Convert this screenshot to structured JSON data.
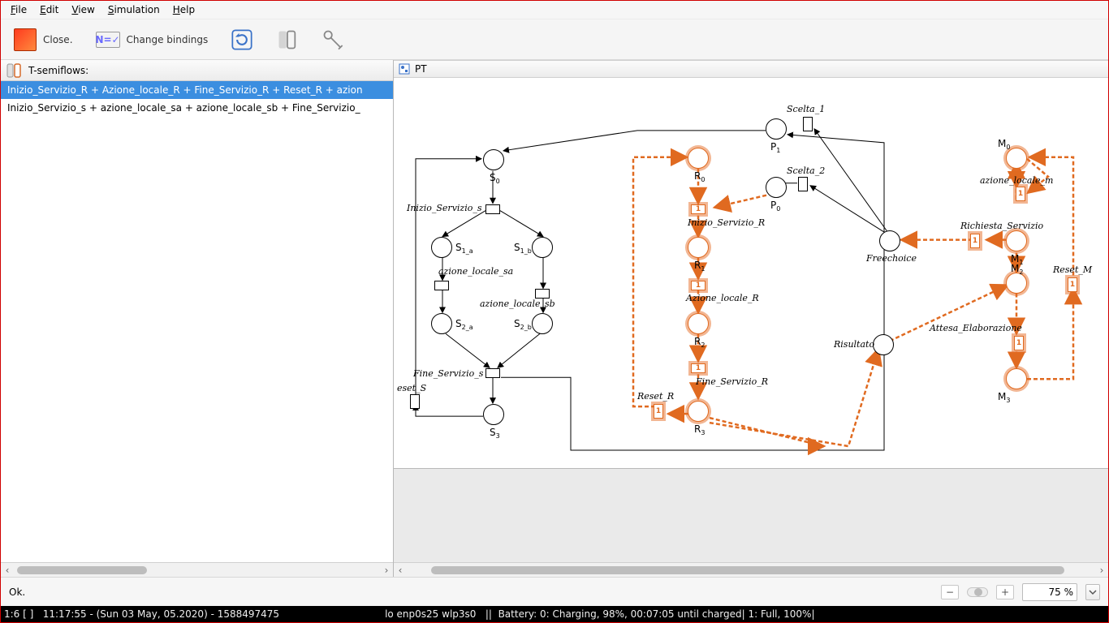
{
  "menubar": {
    "file": "File",
    "edit": "Edit",
    "view": "View",
    "simulation": "Simulation",
    "help": "Help"
  },
  "toolbar": {
    "close_label": "Close.",
    "change_bindings_label": "Change bindings",
    "bindings_icon_text": "N=✓"
  },
  "left": {
    "title": "T-semiflows:",
    "items": [
      "Inizio_Servizio_R + Azione_locale_R + Fine_Servizio_R + Reset_R + azion",
      "Inizio_Servizio_s + azione_locale_sa + azione_locale_sb + Fine_Servizio_"
    ]
  },
  "right": {
    "tab_label": "PT"
  },
  "nodes": {
    "S0": "S",
    "S0s": "0",
    "Inizio_Servizio_s": "Inizio_Servizio_s",
    "S1a": "S",
    "S1a_s": "1_a",
    "S1b": "S",
    "S1b_s": "1_b",
    "az_sa": "azione_locale_sa",
    "az_sb": "azione_locale_sb",
    "S2a": "S",
    "S2a_s": "2_a",
    "S2b": "S",
    "S2b_s": "2_b",
    "Fine_Servizio_s": "Fine_Servizio_s",
    "S3": "S",
    "S3s": "3",
    "reset_S": "eset_S",
    "R0": "R",
    "R0s": "0",
    "Inizio_Servizio_R": "Inizio_Servizio_R",
    "R1": "R",
    "R1s": "1",
    "Azione_locale_R": "Azione_locale_R",
    "R2": "R",
    "R2s": "2",
    "Fine_Servizio_R": "Fine_Servizio_R",
    "R3": "R",
    "R3s": "3",
    "Reset_R": "Reset_R",
    "P0": "P",
    "P0s": "0",
    "P1": "P",
    "P1s": "1",
    "Scelta1": "Scelta_1",
    "Scelta2": "Scelta_2",
    "Freechoice": "Freechoice",
    "Risultato": "Risultato",
    "M0": "M",
    "M0s": "0",
    "M1": "M",
    "M1s": "1",
    "M2": "M",
    "M2s": "2",
    "M3": "M",
    "M3s": "3",
    "az_m": "azione_locale_m",
    "Richiesta_Servizio": "Richiesta_Servizio",
    "Attesa_Elaborazione": "Attesa_Elaborazione",
    "Reset_M": "Reset_M"
  },
  "status": {
    "text": "Ok.",
    "zoom": "75 %"
  },
  "osbar": {
    "left": "1:6 [ ]   11:17:55 - (Sun 03 May, 05.2020) - 1588497475",
    "mid": "lo enp0s25 wlp3s0   ||  Battery: 0: Charging, 98%, 00:07:05 until charged| 1: Full, 100%|"
  }
}
